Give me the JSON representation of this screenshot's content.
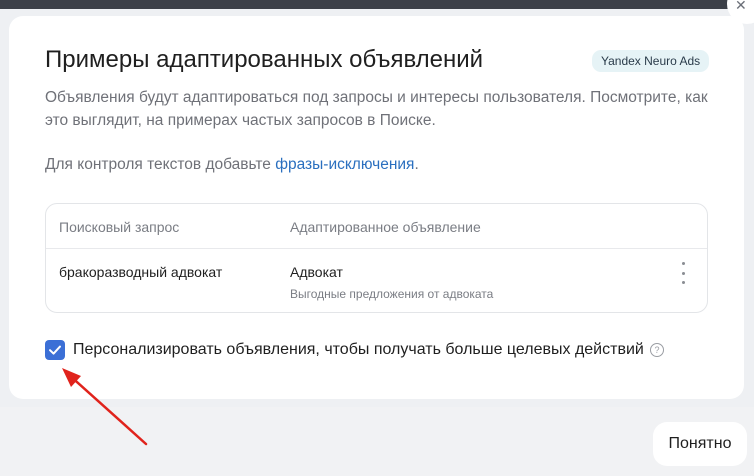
{
  "close": {
    "icon": "close-icon",
    "glyph": "✕"
  },
  "dialog": {
    "title": "Примеры адаптированных объявлений",
    "badge": "Yandex Neuro Ads",
    "description": "Объявления будут адаптироваться под запросы и интересы пользователя. Посмотрите, как это выглядит, на примерах частых запросов в Поиске.",
    "hint_prefix": "Для контроля текстов добавьте ",
    "hint_link": "фразы-исключения",
    "hint_suffix": "."
  },
  "table": {
    "columns": [
      "Поисковый запрос",
      "Адаптированное объявление"
    ],
    "rows": [
      {
        "query": "бракоразводный адвокат",
        "ad_title": "Адвокат",
        "ad_text": "Выгодные предложения от адвоката"
      }
    ]
  },
  "personalize": {
    "checked": true,
    "label": "Персонализировать объявления, чтобы получать больше целевых действий",
    "help": "?"
  },
  "footer": {
    "ok_label": "Понятно"
  },
  "colors": {
    "accent": "#3b6fd6",
    "link": "#2a6fbf",
    "arrow": "#e0231c",
    "badge_bg": "#e6f3f6"
  }
}
